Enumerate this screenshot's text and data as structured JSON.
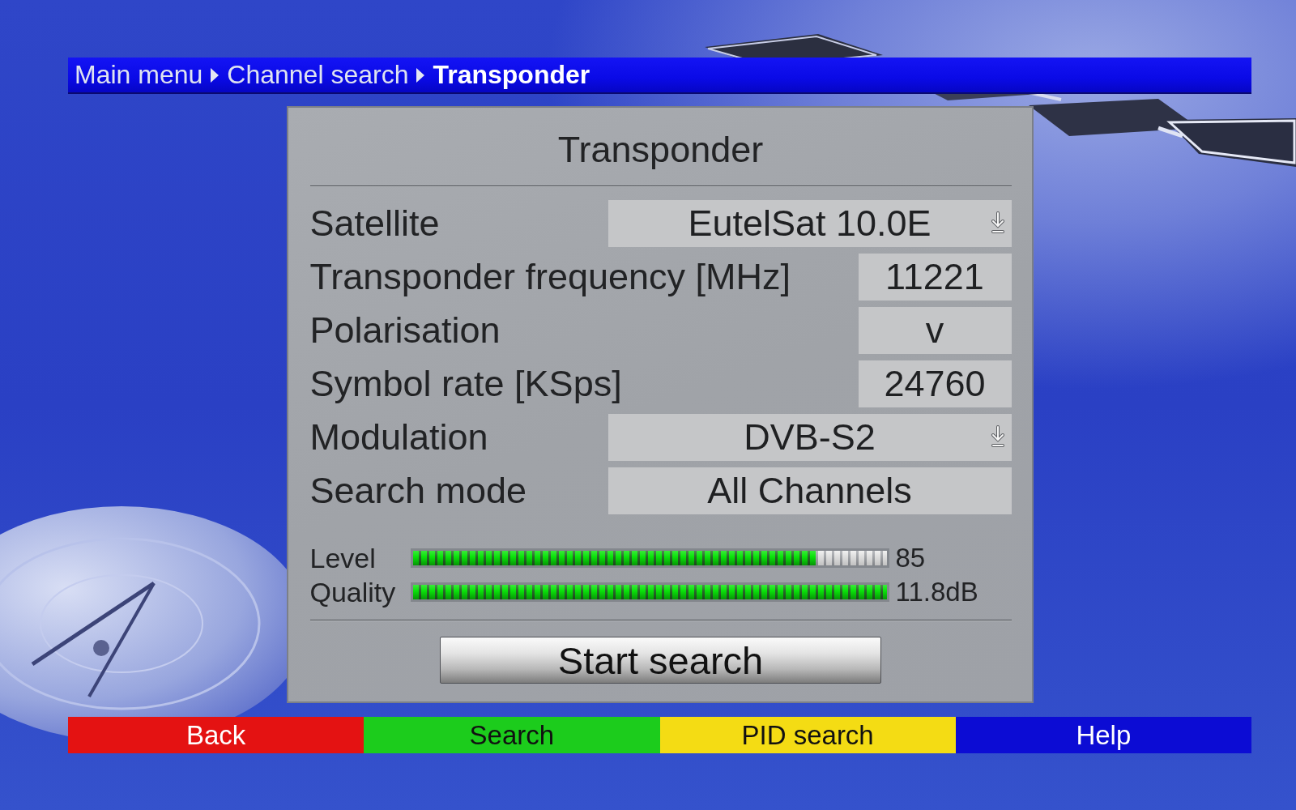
{
  "breadcrumb": [
    {
      "label": "Main menu",
      "current": false
    },
    {
      "label": "Channel search",
      "current": false
    },
    {
      "label": "Transponder",
      "current": true
    }
  ],
  "dialog": {
    "title": "Transponder",
    "fields": [
      {
        "label": "Satellite",
        "value": "EutelSat 10.0E",
        "kind": "dropdown"
      },
      {
        "label": "Transponder frequency [MHz]",
        "value": "11221",
        "kind": "entry"
      },
      {
        "label": "Polarisation",
        "value": "v",
        "kind": "entry"
      },
      {
        "label": "Symbol rate [KSps]",
        "value": "24760",
        "kind": "entry"
      },
      {
        "label": "Modulation",
        "value": "DVB-S2",
        "kind": "dropdown"
      },
      {
        "label": "Search mode",
        "value": "All Channels",
        "kind": "choice"
      }
    ],
    "meters": [
      {
        "label": "Level",
        "level": 0.85,
        "reading": "85"
      },
      {
        "label": "Quality",
        "level": 1,
        "reading": "11.8dB"
      }
    ],
    "action_button": "Start search"
  },
  "function_keys": [
    {
      "label": "Back",
      "color": "#e41212"
    },
    {
      "label": "Search",
      "color": "#1ccc1c"
    },
    {
      "label": "PID search",
      "color": "#f4dc14"
    },
    {
      "label": "Help",
      "color": "#0c0cd4"
    }
  ]
}
